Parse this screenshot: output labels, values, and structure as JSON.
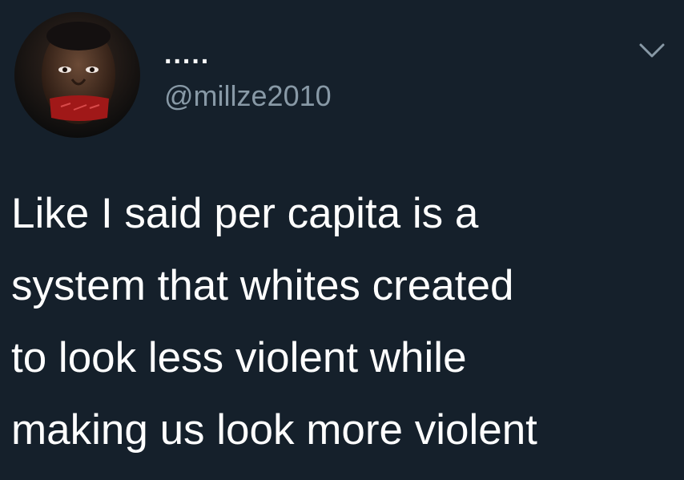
{
  "tweet": {
    "author": {
      "display_name": ".....",
      "handle": "@millze2010",
      "avatar_icon": "profile-photo-avatar"
    },
    "menu_icon": "chevron-down-icon",
    "text": "Like I said per capita is a\nsystem that whites created\nto look less violent while\nmaking us look more violent"
  },
  "colors": {
    "background": "#15202b",
    "text": "#ffffff",
    "secondary_text": "#8899a6"
  }
}
